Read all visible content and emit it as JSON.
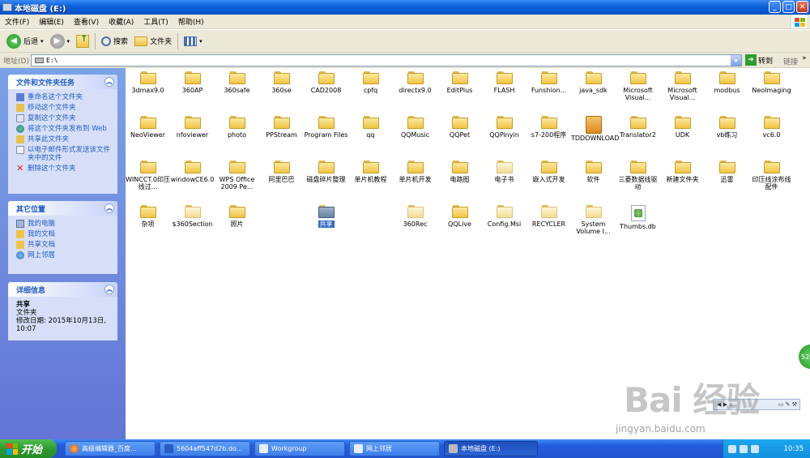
{
  "window": {
    "title": "本地磁盘 (E:)"
  },
  "menu": [
    "文件(F)",
    "编辑(E)",
    "查看(V)",
    "收藏(A)",
    "工具(T)",
    "帮助(H)"
  ],
  "toolbar": {
    "back": "后退",
    "search": "搜索",
    "folders": "文件夹"
  },
  "address": {
    "label": "地址(D)",
    "value": "E:\\",
    "go": "转到",
    "links": "链接"
  },
  "left_pane": {
    "file_tasks": {
      "title": "文件和文件夹任务",
      "items": [
        "重命名这个文件夹",
        "移动这个文件夹",
        "复制这个文件夹",
        "将这个文件夹发布到 Web",
        "共享此文件夹",
        "以电子邮件形式发送该文件夹中的文件",
        "删除这个文件夹"
      ]
    },
    "other_places": {
      "title": "其它位置",
      "items": [
        "我的电脑",
        "我的文档",
        "共享文档",
        "网上邻居"
      ]
    },
    "details": {
      "title": "详细信息",
      "name": "共享",
      "type": "文件夹",
      "modified": "修改日期: 2015年10月13日, 10:07"
    }
  },
  "files": [
    {
      "name": "3dmax9.0",
      "kind": "folder"
    },
    {
      "name": "360AP",
      "kind": "folder"
    },
    {
      "name": "360safe",
      "kind": "folder"
    },
    {
      "name": "360se",
      "kind": "folder"
    },
    {
      "name": "CAD2008",
      "kind": "folder"
    },
    {
      "name": "cpfq",
      "kind": "folder"
    },
    {
      "name": "directx9.0",
      "kind": "folder"
    },
    {
      "name": "EditPlus",
      "kind": "folder"
    },
    {
      "name": "FLASH",
      "kind": "folder"
    },
    {
      "name": "Funshion...",
      "kind": "folder"
    },
    {
      "name": "java_sdk",
      "kind": "folder"
    },
    {
      "name": "Microsoft Visual...",
      "kind": "folder"
    },
    {
      "name": "Microsoft Visual...",
      "kind": "folder"
    },
    {
      "name": "modbus",
      "kind": "folder"
    },
    {
      "name": "NeoImaging",
      "kind": "folder"
    },
    {
      "name": "NeoViewer",
      "kind": "folder"
    },
    {
      "name": "nfoviewer",
      "kind": "folder"
    },
    {
      "name": "photo",
      "kind": "folder"
    },
    {
      "name": "PPStream",
      "kind": "folder"
    },
    {
      "name": "Program Files",
      "kind": "folder"
    },
    {
      "name": "qq",
      "kind": "folder"
    },
    {
      "name": "QQMusic",
      "kind": "folder"
    },
    {
      "name": "QQPet",
      "kind": "folder"
    },
    {
      "name": "QQPinyin",
      "kind": "folder"
    },
    {
      "name": "s7-200程序",
      "kind": "folder"
    },
    {
      "name": "TDDOWNLOAD",
      "kind": "special"
    },
    {
      "name": "Translator2",
      "kind": "folder"
    },
    {
      "name": "UDK",
      "kind": "folder"
    },
    {
      "name": "vb练习",
      "kind": "folder"
    },
    {
      "name": "vc6.0",
      "kind": "folder"
    },
    {
      "name": "WINCCT.0印压线过...",
      "kind": "folder"
    },
    {
      "name": "windowCE6.0",
      "kind": "folder"
    },
    {
      "name": "WPS Office 2009 Pe...",
      "kind": "folder"
    },
    {
      "name": "阿里巴巴",
      "kind": "folder"
    },
    {
      "name": "磁盘碎片整理",
      "kind": "folder"
    },
    {
      "name": "单片机教程",
      "kind": "folder"
    },
    {
      "name": "单片机开发",
      "kind": "folder"
    },
    {
      "name": "电路图",
      "kind": "folder"
    },
    {
      "name": "电子书",
      "kind": "faded"
    },
    {
      "name": "嵌入式开发",
      "kind": "folder"
    },
    {
      "name": "软件",
      "kind": "folder"
    },
    {
      "name": "三菱数据线驱动",
      "kind": "folder"
    },
    {
      "name": "新建文件夹",
      "kind": "folder"
    },
    {
      "name": "迅雷",
      "kind": "folder"
    },
    {
      "name": "印压线涂布线配件",
      "kind": "folder"
    },
    {
      "name": "杂项",
      "kind": "folder"
    },
    {
      "name": "$360Section",
      "kind": "faded"
    },
    {
      "name": "照片",
      "kind": "folder"
    },
    {
      "name": "",
      "kind": "empty"
    },
    {
      "name": "共享",
      "kind": "shared"
    },
    {
      "name": "",
      "kind": "empty"
    },
    {
      "name": "360Rec",
      "kind": "faded"
    },
    {
      "name": "QQLive",
      "kind": "folder"
    },
    {
      "name": "Config.Msi",
      "kind": "faded"
    },
    {
      "name": "RECYCLER",
      "kind": "faded"
    },
    {
      "name": "System Volume I...",
      "kind": "faded"
    },
    {
      "name": "Thumbs.db",
      "kind": "file"
    }
  ],
  "watermark": {
    "brand": "Bai 经验",
    "url": "jingyan.baidu.com"
  },
  "taskbar": {
    "start": "开始",
    "buttons": [
      "高级编辑器_百度...",
      "5604aff547d2b.do...",
      "Workgroup",
      "网上邻居",
      "本地磁盘 (E:)"
    ],
    "clock": "10:35"
  }
}
